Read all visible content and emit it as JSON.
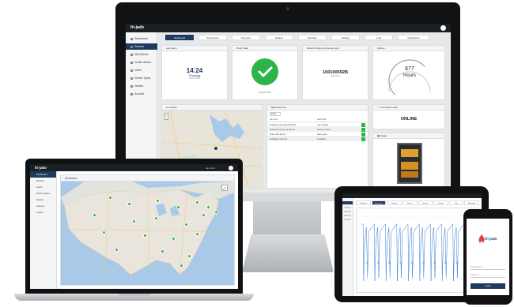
{
  "desktop": {
    "brand": "fri-jado",
    "sidebar": [
      {
        "label": "Dashboard",
        "active": false
      },
      {
        "label": "Devices",
        "active": true
      },
      {
        "label": "My Devices",
        "active": false
      },
      {
        "label": "Create device",
        "active": false
      },
      {
        "label": "Users",
        "active": false
      },
      {
        "label": "Device Types",
        "active": false
      },
      {
        "label": "Version",
        "active": false
      },
      {
        "label": "Account",
        "active": false
      }
    ],
    "tabs": [
      "Dashboard",
      "Temperature",
      "Telemetry",
      "Recipes",
      "Firmware",
      "Settings",
      "Logs",
      "Subscription"
    ],
    "last_seen": {
      "title": "Last Seen",
      "time": "14:24",
      "day": "Thursday",
      "date": "09-04-2020"
    },
    "oven_state": {
      "title": "Oven State",
      "status": "Device is OK"
    },
    "serial": {
      "title": "Serial number and device type",
      "number": "100100592B",
      "type": "Multi-Deck"
    },
    "uptime": {
      "title": "Uptime",
      "value": "677",
      "unit": "Hours",
      "value_number": 677,
      "max": 1000
    },
    "location": {
      "title": "Location"
    },
    "documents": {
      "title": "Documents",
      "filter_label": "Filter",
      "columns": [
        "File name",
        "Description"
      ],
      "rows": [
        [
          "Multi-deck user manual EN.pdf",
          "User manual"
        ],
        [
          "Multi-deck service manual.pdf",
          "Service manual"
        ],
        [
          "Spare parts list.pdf",
          "Spare parts"
        ],
        [
          "Installation guide.pdf",
          "Installation"
        ]
      ]
    },
    "connection": {
      "title": "Connection state",
      "status": "ONLINE"
    },
    "image_card": {
      "title": "Image"
    }
  },
  "laptop": {
    "brand": "fri-jado",
    "user": "Jan Smit",
    "sidebar": [
      "Dashboard",
      "Devices",
      "Users",
      "Device Types",
      "Version",
      "Account",
      "Logout"
    ],
    "map_title": "All devices"
  },
  "tablet": {
    "tabs": [
      "Dashboard",
      "Temperature",
      "Telemetry",
      "Recipes",
      "Firmware",
      "Settings",
      "Logs",
      "Subscription"
    ],
    "chart_labels": [
      "21",
      "22",
      "25",
      "24",
      "17",
      "21",
      "33",
      "31",
      "34",
      "45"
    ]
  },
  "phone": {
    "logo_text": "fri-jado",
    "fields": [
      "Email address",
      "Password"
    ],
    "button": "Login"
  },
  "colors": {
    "accent": "#1e3a5f",
    "ok_green": "#2db34a",
    "marker": "#3cb043"
  }
}
